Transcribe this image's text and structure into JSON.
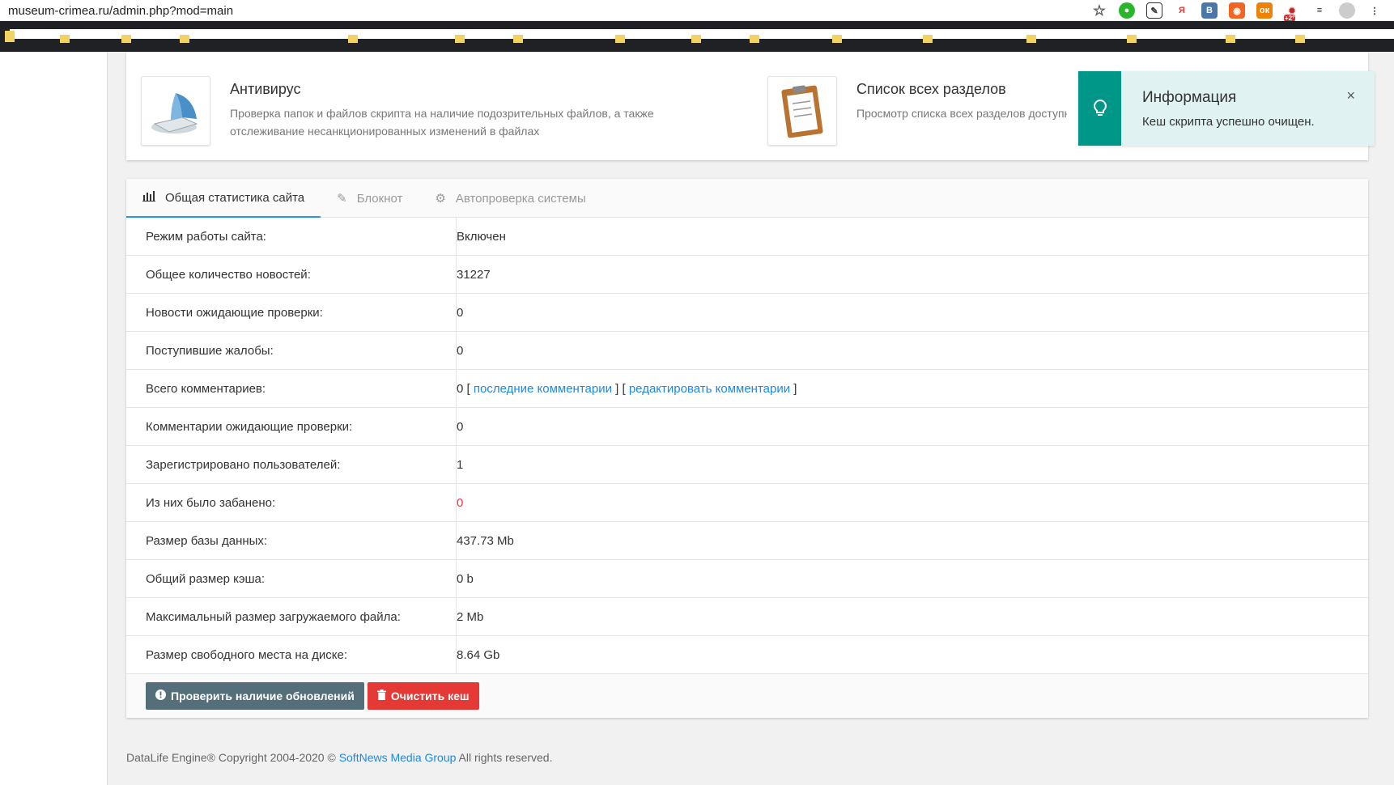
{
  "browser": {
    "url": "museum-crimea.ru/admin.php?mod=main",
    "ext_badge": "+2°"
  },
  "modules": [
    {
      "title": "Антивирус",
      "desc": "Проверка папок и файлов скрипта на наличие подозрительных файлов, а также отслеживание несанкционированных изменений в файлах"
    },
    {
      "title": "Список всех разделов",
      "desc": "Просмотр списка всех разделов доступны"
    }
  ],
  "notification": {
    "title": "Информация",
    "text": "Кеш скрипта успешно очищен.",
    "close": "×"
  },
  "tabs": [
    {
      "label": "Общая статистика сайта",
      "icon": "bar-chart-icon"
    },
    {
      "label": "Блокнот",
      "icon": "edit-icon"
    },
    {
      "label": "Автопроверка системы",
      "icon": "gear-icon"
    }
  ],
  "stats": {
    "rows": [
      {
        "label": "Режим работы сайта:",
        "value": "Включен"
      },
      {
        "label": "Общее количество новостей:",
        "value": "31227"
      },
      {
        "label": "Новости ожидающие проверки:",
        "value": "0"
      },
      {
        "label": "Поступившие жалобы:",
        "value": "0"
      },
      {
        "label": "Всего комментариев:",
        "value": "0"
      },
      {
        "label": "Комментарии ожидающие проверки:",
        "value": "0"
      },
      {
        "label": "Зарегистрировано пользователей:",
        "value": "1"
      },
      {
        "label": "Из них было забанено:",
        "value": "0"
      },
      {
        "label": "Размер базы данных:",
        "value": "437.73 Mb"
      },
      {
        "label": "Общий размер кэша:",
        "value": "0 b"
      },
      {
        "label": "Максимальный размер загружаемого файла:",
        "value": "2 Mb"
      },
      {
        "label": "Размер свободного места на диске:",
        "value": "8.64 Gb"
      }
    ],
    "comment_links": {
      "open1": "[",
      "last": "последние комментарии",
      "mid": "] [",
      "edit": "редактировать комментарии",
      "close": "]"
    }
  },
  "buttons": {
    "check_updates": "Проверить наличие обновлений",
    "clear_cache": "Очистить кеш"
  },
  "footer": {
    "prefix": "DataLife Engine® Copyright 2004-2020 ©",
    "company": "SoftNews Media Group",
    "suffix": "All rights reserved."
  },
  "colors": {
    "accent": "#2196f3",
    "notify_teal": "#009688",
    "btn_dark": "#546e7a",
    "btn_red": "#e53935"
  }
}
